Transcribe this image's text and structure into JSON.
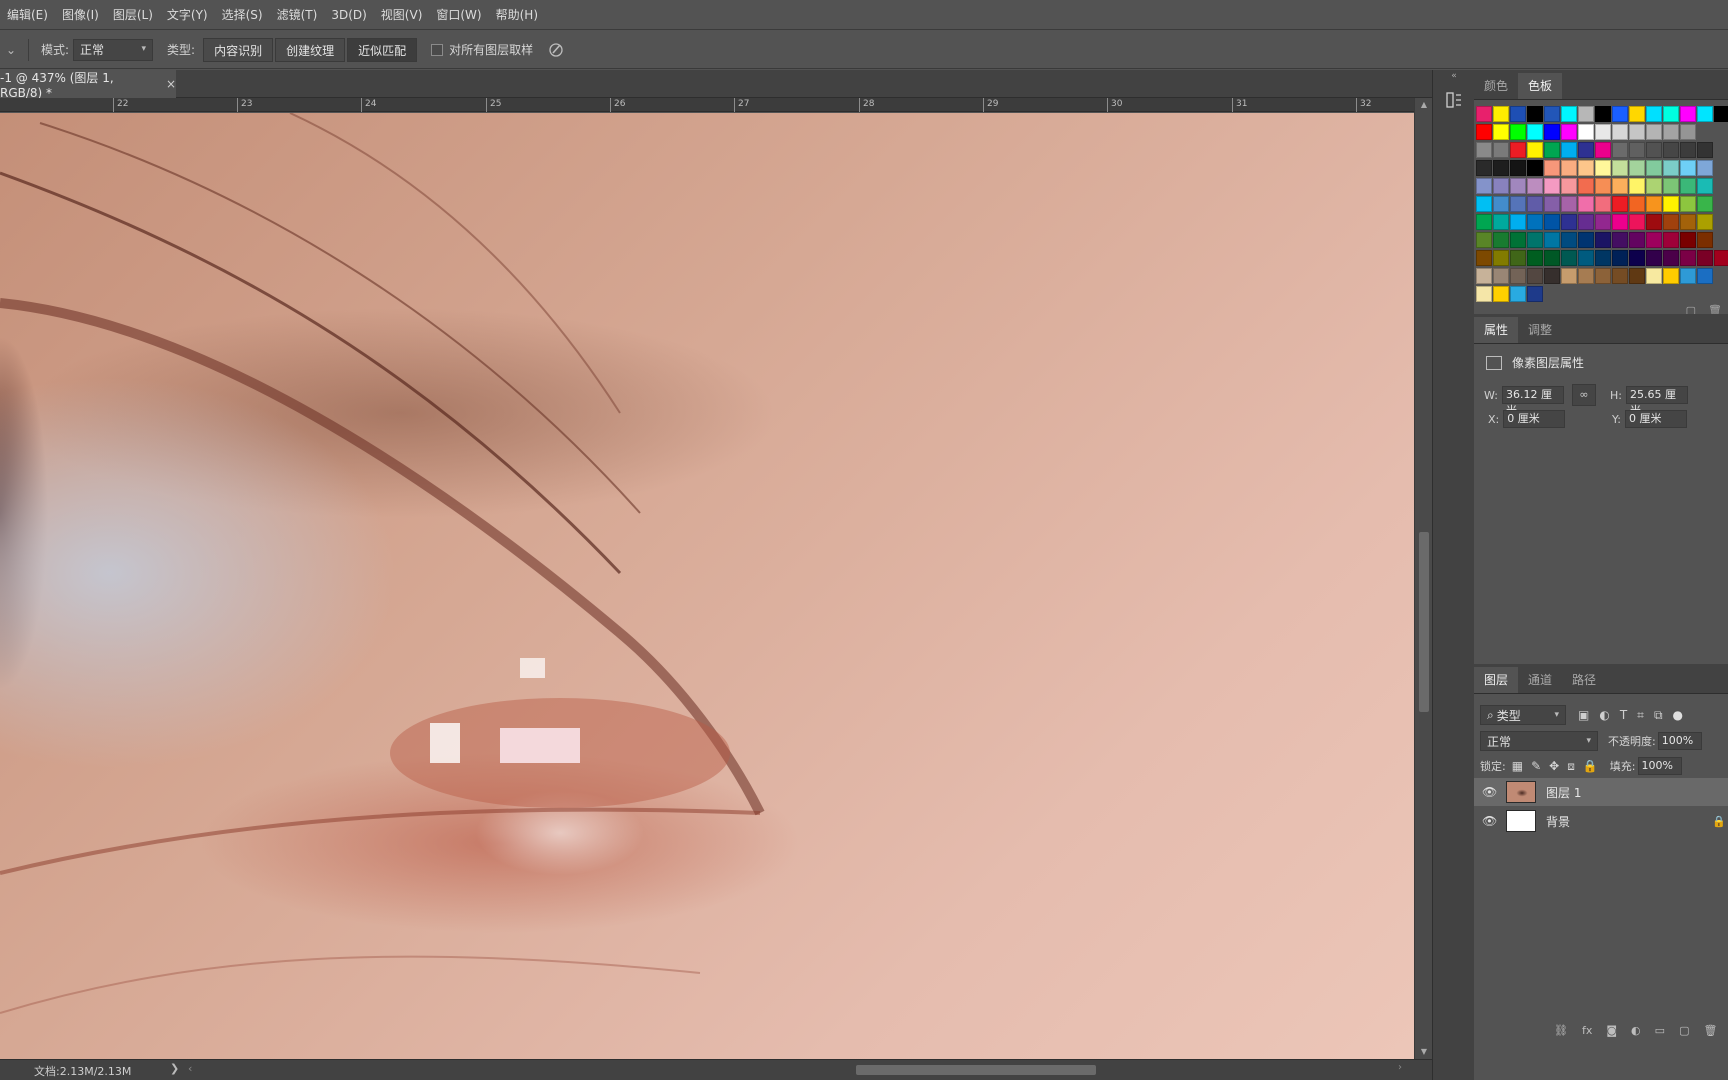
{
  "menu": [
    "编辑(E)",
    "图像(I)",
    "图层(L)",
    "文字(Y)",
    "选择(S)",
    "滤镜(T)",
    "3D(D)",
    "视图(V)",
    "窗口(W)",
    "帮助(H)"
  ],
  "options": {
    "mode_label": "模式:",
    "mode_value": "正常",
    "type_label": "类型:",
    "type_buttons": [
      "内容识别",
      "创建纹理",
      "近似匹配"
    ],
    "active_type": "近似匹配",
    "sample_all_label": "对所有图层取样",
    "sample_all_checked": false
  },
  "document": {
    "tab_title": "-1 @ 437% (图层 1, RGB/8) *",
    "close_glyph": "×",
    "zoom_percent": 437
  },
  "ruler": {
    "labels": [
      "22",
      "23",
      "24",
      "25",
      "26",
      "27",
      "28",
      "29",
      "30",
      "31",
      "32"
    ]
  },
  "status": {
    "doc_info": "文档:2.13M/2.13M",
    "arrow": "❯"
  },
  "swatches_panel": {
    "tabs": [
      "颜色",
      "色板"
    ],
    "active_tab": "色板",
    "rows": [
      [
        "#e8206c",
        "#ffed00",
        "#1e4fb4",
        "#000000",
        "#2256b8",
        "#00f6ff",
        "#b7b7b7",
        "#000000",
        "#1a5fff",
        "#ffd700",
        "#00e0ff",
        "#00ffe0",
        "#ff00ff",
        "#00e5ff",
        "#000000",
        "#ffffff"
      ],
      [
        "#ff0000",
        "#ffff00",
        "#00ff00",
        "#00ffff",
        "#0000ff",
        "#ff00ff",
        "#ffffff",
        "#e8e8e8",
        "#d6d6d6",
        "#c6c6c6",
        "#b4b4b4",
        "#a4a4a4",
        "#959595"
      ],
      [
        "#8a8a8a",
        "#7a7a7a",
        "#ed1c24",
        "#fff200",
        "#00a651",
        "#00aeef",
        "#2e3192",
        "#ec008c",
        "#6b6b6b",
        "#606060",
        "#525252",
        "#464646",
        "#3c3c3c",
        "#333333"
      ],
      [
        "#2a2a2a",
        "#1e1e1e",
        "#141414",
        "#000000",
        "#f7977a",
        "#f9ad81",
        "#fdc68a",
        "#fff79a",
        "#c4df9b",
        "#a3d39c",
        "#82ca9d",
        "#7bcdc8",
        "#6ecff6",
        "#7ea7d8"
      ],
      [
        "#8493ca",
        "#8882be",
        "#a187be",
        "#bc8dbf",
        "#f49ac2",
        "#f6989d",
        "#f26c4f",
        "#f68e55",
        "#fbaf5c",
        "#fff467",
        "#acd372",
        "#7cc576",
        "#3bb878",
        "#1abbb4"
      ],
      [
        "#00bff3",
        "#438ccb",
        "#5574b9",
        "#605ca8",
        "#855fa8",
        "#a763a8",
        "#f06eaa",
        "#f26d7d",
        "#ed1c24",
        "#f26522",
        "#f7941d",
        "#fff200",
        "#8dc63f",
        "#39b54a"
      ],
      [
        "#00a651",
        "#00a99d",
        "#00aeef",
        "#0072bc",
        "#0054a6",
        "#2e3192",
        "#662d91",
        "#92278f",
        "#ec008c",
        "#ed145b",
        "#9e0b0f",
        "#a0410d",
        "#a3620a",
        "#aba000"
      ],
      [
        "#598527",
        "#197b30",
        "#007236",
        "#00746b",
        "#0076a3",
        "#004b80",
        "#003471",
        "#1b1464",
        "#440e62",
        "#630460",
        "#9e005d",
        "#9e0039",
        "#790000",
        "#7b2e00"
      ],
      [
        "#7d4900",
        "#827b00",
        "#406618",
        "#005e20",
        "#005826",
        "#005952",
        "#005b7f",
        "#003663",
        "#002157",
        "#0d004c",
        "#32004b",
        "#4b0049",
        "#7b0046",
        "#7a0026",
        "#a2001d"
      ],
      [
        "#c7b299",
        "#998675",
        "#736357",
        "#534741",
        "#362f2d",
        "#c69c6d",
        "#a67c52",
        "#8c6239",
        "#754c24",
        "#603913",
        "#f7e9a0",
        "#ffcc00",
        "#2e9ad6",
        "#1b6ec2"
      ],
      [
        "#f5e6a8",
        "#ffd000",
        "#29aae1",
        "#1e3a8a"
      ]
    ]
  },
  "properties_panel": {
    "tabs": [
      "属性",
      "调整"
    ],
    "active_tab": "属性",
    "title": "像素图层属性",
    "w_label": "W:",
    "w_value": "36.12 厘米",
    "h_label": "H:",
    "h_value": "25.65 厘米",
    "x_label": "X:",
    "x_value": "0 厘米",
    "y_label": "Y:",
    "y_value": "0 厘米",
    "link_glyph": "∞"
  },
  "layers_panel": {
    "tabs": [
      "图层",
      "通道",
      "路径"
    ],
    "active_tab": "图层",
    "filter_value": "类型",
    "blend_mode": "正常",
    "opacity_label": "不透明度:",
    "opacity_value": "100%",
    "lock_label": "锁定:",
    "fill_label": "填充:",
    "fill_value": "100%",
    "layers": [
      {
        "name": "图层 1",
        "selected": true,
        "visible": true,
        "locked": false
      },
      {
        "name": "背景",
        "selected": false,
        "visible": true,
        "locked": true
      }
    ]
  },
  "colors": {
    "ui_bg": "#535353",
    "panel_dark": "#424242",
    "selected_layer": "#696969"
  }
}
